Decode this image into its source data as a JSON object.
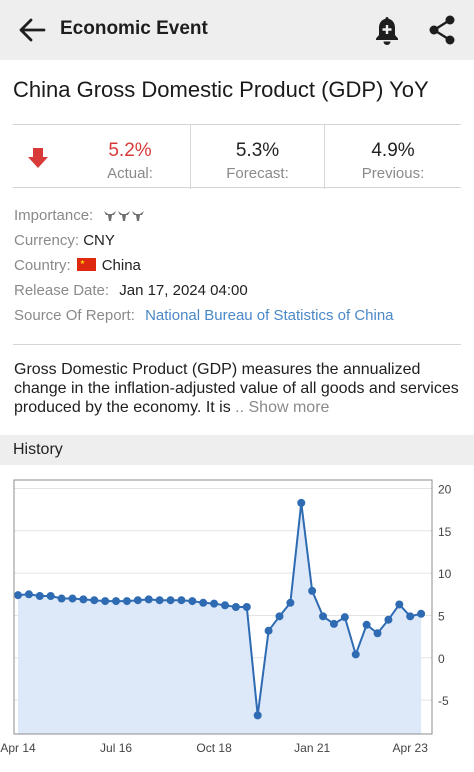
{
  "header": {
    "title": "Economic Event",
    "back_icon": "arrow-left-icon",
    "alert_icon": "bell-add-icon",
    "share_icon": "share-icon"
  },
  "event": {
    "title": "China Gross Domestic Product (GDP) YoY",
    "direction_icon": "arrow-down-icon",
    "actual_value": "5.2%",
    "actual_label": "Actual:",
    "forecast_value": "5.3%",
    "forecast_label": "Forecast:",
    "previous_value": "4.9%",
    "previous_label": "Previous:"
  },
  "details": {
    "importance_label": "Importance:",
    "importance_level": 3,
    "currency_label": "Currency:",
    "currency_value": "CNY",
    "country_label": "Country:",
    "country_value": "China",
    "release_label": "Release Date:",
    "release_value": "Jan 17, 2024 04:00",
    "source_label": "Source Of Report:",
    "source_value": "National Bureau of Statistics of China"
  },
  "description": {
    "text": "Gross Domestic Product (GDP) measures the annualized change in the inflation-adjusted value of all goods and services produced by the economy. It is",
    "show_more": ".. Show more"
  },
  "history": {
    "title": "History"
  },
  "colors": {
    "actual": "#d83a3a",
    "line": "#2e6bb3",
    "area": "#dde8f8",
    "link": "#4a88c7"
  },
  "chart_data": {
    "type": "area",
    "x": [
      "Apr 14",
      "Jul 14",
      "Oct 14",
      "Jan 15",
      "Apr 15",
      "Jul 15",
      "Oct 15",
      "Jan 16",
      "Apr 16",
      "Jul 16",
      "Oct 16",
      "Jan 17",
      "Apr 17",
      "Jul 17",
      "Oct 17",
      "Jan 18",
      "Apr 18",
      "Jul 18",
      "Oct 18",
      "Jan 19",
      "Apr 19",
      "Jul 19",
      "Oct 19",
      "Jan 20",
      "Apr 20",
      "Jul 20",
      "Oct 20",
      "Jan 21",
      "Apr 21",
      "Jul 21",
      "Oct 21",
      "Jan 22",
      "Apr 22",
      "Jul 22",
      "Oct 22",
      "Jan 23",
      "Apr 23",
      "Jul 23",
      "Oct 23"
    ],
    "values": [
      7.4,
      7.5,
      7.3,
      7.3,
      7.0,
      7.0,
      6.9,
      6.8,
      6.7,
      6.7,
      6.7,
      6.8,
      6.9,
      6.8,
      6.8,
      6.8,
      6.7,
      6.5,
      6.4,
      6.2,
      6.0,
      6.0,
      -6.8,
      3.2,
      4.9,
      6.5,
      18.3,
      7.9,
      4.9,
      4.0,
      4.8,
      0.4,
      3.9,
      2.9,
      4.5,
      6.3,
      4.9,
      5.2
    ],
    "x_ticks": [
      "Apr 14",
      "Jul 16",
      "Oct 18",
      "Jan 21",
      "Apr 23"
    ],
    "y_ticks": [
      20,
      15,
      10,
      5,
      0,
      -5
    ],
    "ylim": [
      -9,
      21
    ],
    "y_axis_side": "right",
    "grid": true
  }
}
